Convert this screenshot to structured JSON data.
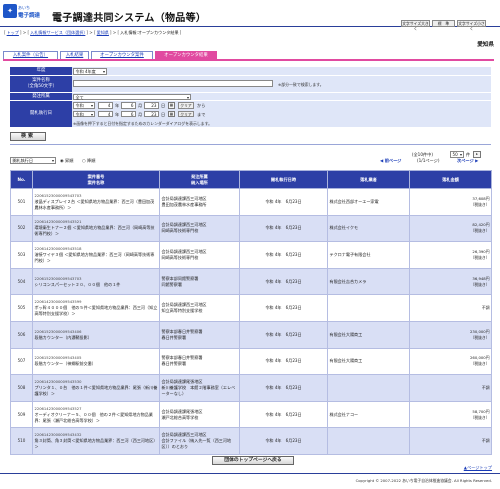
{
  "header": {
    "logo_small": "あいち",
    "logo_name": "電子調達",
    "system_title": "電子調達共同システム（物品等）",
    "font_large_label": "文字サイズ大きく",
    "font_standard_label": "標　準",
    "font_small_label": "文字サイズ小さく"
  },
  "breadcrumb": [
    "トップ",
    "入札情報サービス（団体選択）",
    "愛知県",
    "入札情報:オープンカウンタ結果"
  ],
  "organization": "愛知県",
  "tabs": [
    "入札案件（公告）",
    "入札結果",
    "オープンカウンタ案件",
    "オープンカウンタ結果"
  ],
  "form": {
    "fiscal_year_label": "年度",
    "fiscal_year_value": "令和 4年度",
    "case_name_label": "案件名称",
    "case_name_sub": "（全角50文字）",
    "case_name_note": "※部分一致で検索します。",
    "department_label": "発注所属",
    "department_value": "全て",
    "date_label": "開札執行日",
    "from_era": "令和",
    "from_year": "4",
    "from_month": "6",
    "from_day": "23",
    "to_era": "令和",
    "to_year": "4",
    "to_month": "6",
    "to_day": "23",
    "year_unit": "年",
    "month_unit": "月",
    "day_unit": "日",
    "calendar_label": "cal",
    "clear_label": "クリア",
    "from_suffix": "から",
    "to_suffix": "まで",
    "calendar_note": "※画像を押下すると日付を指定するためのカレンダーダイアログを表示します。",
    "search_label": "検索"
  },
  "sort": {
    "field": "開札執行日",
    "asc_label": "昇順",
    "desc_label": "降順"
  },
  "pager": {
    "count_text": "(全10件中)",
    "page_size": "50",
    "page_size_suffix": "件",
    "prev_label": "前ページ",
    "page_info": "1/1ページ",
    "next_label": "次ページ"
  },
  "table": {
    "headers": {
      "no": "No.",
      "case_line1": "案件番号",
      "case_line2": "案件名称",
      "dept_line1": "発注所属",
      "dept_line2": "納入場所",
      "date": "開札執行日時",
      "bidder": "落札業者",
      "amount": "落札金額"
    },
    "rows": [
      {
        "no": "501",
        "number": "22061523000009543703",
        "name": "液晶ディスプレイ２台 ＜愛知県地方物品業界：西三河（豊田加茂農林水産事務所）＞",
        "dept": "会計局調達課西三河地区",
        "place": "豊田加茂農林水産事務所",
        "date": "令和 4年　6月23日",
        "bidder": "株式会社西部オーエー家電",
        "amount": "37,608円",
        "tax": "（税抜き）"
      },
      {
        "no": "502",
        "number": "22061423000009543521",
        "name": "環境衛生トナー２個 ＜愛知県地方物品業界：西三河（岡崎高等技術専門校）＞",
        "dept": "会計局調達課西三河地区",
        "place": "岡崎高等技術専門校",
        "date": "令和 4年　6月23日",
        "bidder": "株式会社イクモ",
        "amount": "82,420円",
        "tax": "（税抜き）"
      },
      {
        "no": "503",
        "number": "22061423000009543518",
        "name": "溶接ワイヤ３個 ＜愛知県地方物品業界：西三河（岡崎高等技術専門校）＞",
        "dept": "会計局調達課西三河地区",
        "place": "岡崎高等技術専門校",
        "date": "令和 4年　6月23日",
        "bidder": "テクロナ電子有限会社",
        "amount": "26,390円",
        "tax": "（税抜き）"
      },
      {
        "no": "504",
        "number": "22061523000009543703",
        "name": "シリコンスパーセット２０、００個　他の１件",
        "dept": "警察本部同館警察署",
        "place": "同館警察署",
        "date": "令和 4年　6月23日",
        "bidder": "有限会社吉合カメラ",
        "amount": "36,948円",
        "tax": "（税抜き）"
      },
      {
        "no": "505",
        "number": "22061423000009543599",
        "name": "ボッ幹４０００個　他の５件＜愛知県地方物品業界：西三河（知立高等特別支援学校）＞",
        "dept": "会計局調達課西三河地区",
        "place": "知立高等特別支援学校",
        "date": "令和 4年　6月23日",
        "bidder": "",
        "amount": "不調",
        "tax": ""
      },
      {
        "no": "506",
        "number": "22061523000009543406",
        "name": "段階カウンター（内濃鞘投影）",
        "dept": "警察本部春日井警察署",
        "place": "春日井警察署",
        "date": "令和 4年　6月23日",
        "bidder": "有限会社大陽商工",
        "amount": "230,000円",
        "tax": "（税抜き）"
      },
      {
        "no": "507",
        "number": "22061523000009543405",
        "name": "段階カウンター（神郷駅前交番）",
        "dept": "警察本部春日井警察署",
        "place": "春日井警察署",
        "date": "令和 4年　6月23日",
        "bidder": "有限会社大陽商工",
        "amount": "260,000円",
        "tax": "（税抜き）"
      },
      {
        "no": "508",
        "number": "22061423000009543530",
        "name": "プリンタ１、０台　他の１件＜愛知県地方物品業界：尾張（新川養護学校）＞",
        "dept": "会計局調達課尾張地区",
        "place": "新川養護学校　本館２階事務室（エレベーターなし）",
        "date": "令和 4年　6月23日",
        "bidder": "",
        "amount": "不調",
        "tax": ""
      },
      {
        "no": "509",
        "number": "22061423000009543527",
        "name": "オーディオクリーナー５、００個　他の２件＜愛知県地方物品業界：尾張（瀬戸北総合高等学校）＞",
        "dept": "会計局調達課尾張地区",
        "place": "瀬戸北総合高等学校",
        "date": "令和 4年　6月23日",
        "bidder": "株式会社ナコー",
        "amount": "58,700円",
        "tax": "（税抜き）"
      },
      {
        "no": "510",
        "number": "22061423000009543432",
        "name": "角３封筒、角３封筒＜愛知県地方物品業界：西三河（西三河地区）＞",
        "dept": "会計局調達課西三河地区",
        "place": "会計ファイル（納入先一覧（西三河地区））のとおり",
        "date": "令和 4年　6月23日",
        "bidder": "",
        "amount": "不調",
        "tax": ""
      }
    ]
  },
  "back_button": "団体のトップページへ戻る",
  "page_top": "▲ページトップ",
  "copyright": "Copyright © 2007-2022 あいち電子自治体推進協議会. All Rights Reserved."
}
